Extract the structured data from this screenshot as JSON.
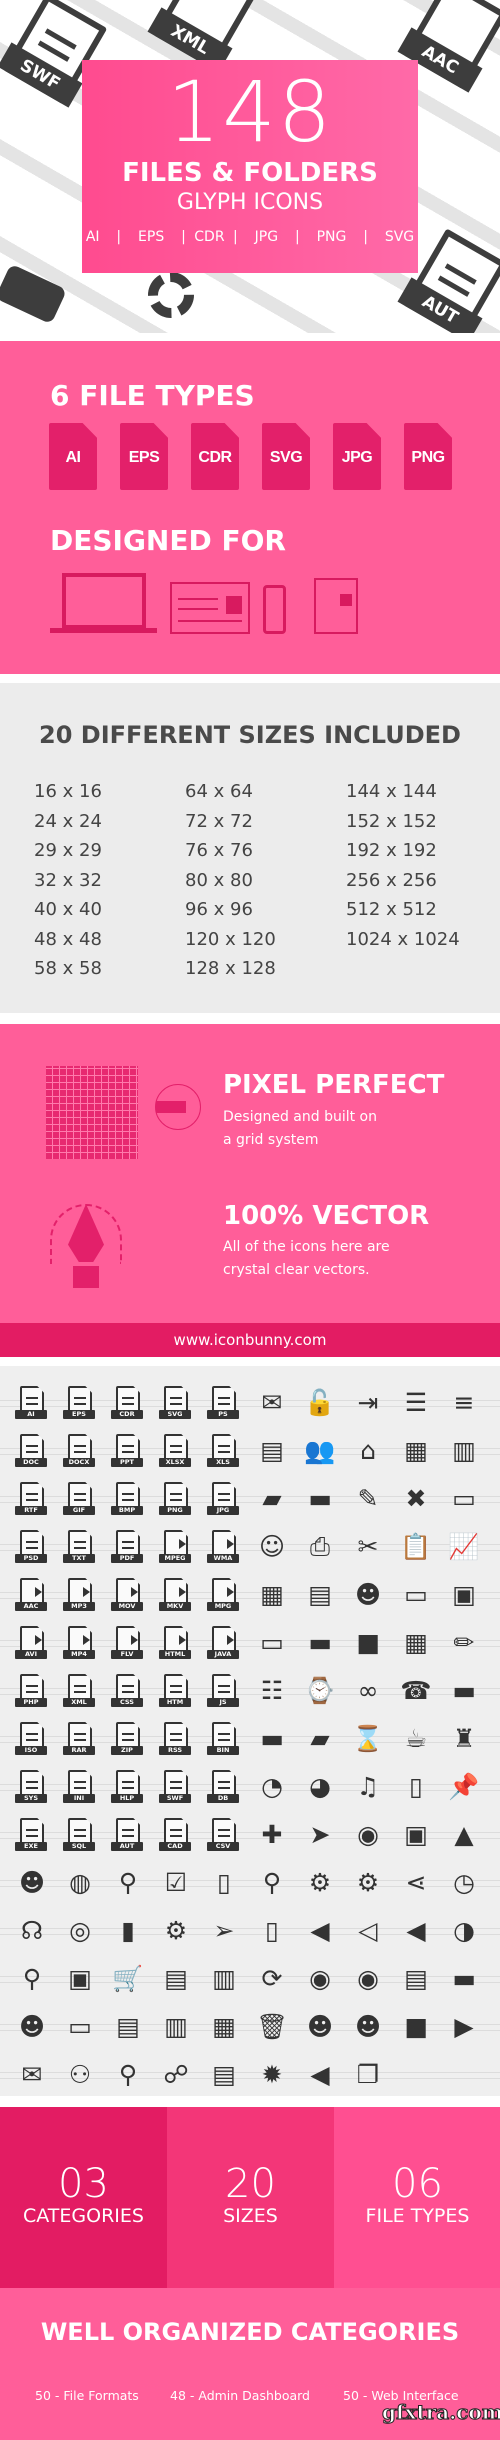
{
  "hero": {
    "count": "148",
    "title": "FILES & FOLDERS",
    "subtitle": "GLYPH ICONS",
    "formats": "AI  |  EPS  | CDR |  JPG  |  PNG  |  SVG",
    "bg_file_labels": [
      "SWF",
      "XML",
      "AAC",
      "AUT"
    ]
  },
  "file_types": {
    "title": "6 FILE TYPES",
    "items": [
      "AI",
      "EPS",
      "CDR",
      "SVG",
      "JPG",
      "PNG"
    ],
    "designed_title": "DESIGNED FOR",
    "devices": [
      "laptop-icon",
      "browser-icon",
      "phone-icon",
      "newspaper-icon"
    ]
  },
  "sizes": {
    "title": "20 DIFFERENT SIZES INCLUDED",
    "columns": [
      [
        "16 x 16",
        "24 x 24",
        "29 x 29",
        "32 x 32",
        "40 x 40",
        "48 x 48",
        "58 x 58"
      ],
      [
        "64 x 64",
        "72 x 72",
        "76 x 76",
        "80 x 80",
        "96 x 96",
        "120 x 120",
        "128 x 128"
      ],
      [
        "144 x 144",
        "152 x 152",
        "192 x 192",
        "256 x 256",
        "512 x 512",
        "1024 x 1024"
      ]
    ]
  },
  "features": {
    "pixel_title": "PIXEL PERFECT",
    "pixel_desc": "Designed and built on a grid system",
    "vector_title": "100% VECTOR",
    "vector_desc": "All of the icons here are crystal clear vectors.",
    "website": "www.iconbunny.com"
  },
  "icon_grid": {
    "file_labels": [
      "AI",
      "EPS",
      "CDR",
      "SVG",
      "PS",
      "DOC",
      "DOCX",
      "PPT",
      "XLSX",
      "XLS",
      "RTF",
      "GIF",
      "BMP",
      "PNG",
      "JPG",
      "PSD",
      "TXT",
      "PDF",
      "MPEG",
      "WMA",
      "AAC",
      "MP3",
      "MOV",
      "MKV",
      "MPG",
      "AVI",
      "MP4",
      "FLV",
      "HTML",
      "JAVA",
      "PHP",
      "XML",
      "CSS",
      "HTM",
      "JS",
      "ISO",
      "RAR",
      "ZIP",
      "RSS",
      "BIN",
      "SYS",
      "INI",
      "HLP",
      "SWF",
      "DB",
      "EXE",
      "SQL",
      "AUT",
      "CAD",
      "CSV"
    ],
    "media_labels": [
      "MPEG",
      "WMA",
      "AAC",
      "MP3",
      "MOV",
      "MKV",
      "MPG",
      "AVI",
      "MP4",
      "FLV",
      "HTML",
      "JAVA"
    ],
    "other_icons": [
      "mail-open",
      "unlock",
      "login",
      "list",
      "align-center",
      "newspaper",
      "users",
      "home",
      "calculator",
      "grid-list",
      "folder-open",
      "folder",
      "edit",
      "close-doc",
      "monitor",
      "user-add",
      "printer",
      "tools",
      "clipboard",
      "chart",
      "calendar",
      "money",
      "user-badge",
      "browser",
      "archive",
      "battery-low",
      "battery-mid",
      "battery-full",
      "calendar-alt",
      "pencil",
      "sliders",
      "watch",
      "glasses",
      "fax",
      "folder-tab",
      "folder-dark",
      "folder-open-dark",
      "hourglass",
      "cup",
      "lamp",
      "clock-sync",
      "refresh-clock",
      "music",
      "notebook",
      "pin",
      "puzzle",
      "send",
      "eye",
      "image",
      "landscape",
      "team",
      "group",
      "location",
      "checklist",
      "tablet",
      "location-pin",
      "gear",
      "gears",
      "share",
      "timer",
      "headset",
      "team-circle",
      "growth",
      "settings",
      "paper-plane",
      "phone-tablet",
      "volume",
      "volume-low",
      "volume-mute",
      "dashboard",
      "search-user",
      "save",
      "cart",
      "document",
      "newspaper-alt",
      "sync",
      "toggle",
      "toggle-on",
      "stack",
      "battery",
      "user-contact",
      "id-card",
      "document-stamp",
      "receipt",
      "calendar-day",
      "trash",
      "user",
      "user-female",
      "video",
      "video-player",
      "chat",
      "network",
      "route",
      "sitemap",
      "server",
      "settings-circle",
      "speaker",
      "windows"
    ]
  },
  "stats": [
    {
      "number": "03",
      "label": "CATEGORIES",
      "color": "#e31c63"
    },
    {
      "number": "20",
      "label": "SIZES",
      "color": "#f33678"
    },
    {
      "number": "06",
      "label": "FILE TYPES",
      "color": "#ff4f91"
    }
  ],
  "categories": {
    "title": "WELL ORGANIZED CATEGORIES",
    "items": [
      "50 - File Formats",
      "48 - Admin Dashboard",
      "50 - Web Interface"
    ]
  },
  "watermark": "gfxtra.com",
  "colors": {
    "pink": "#ff5e99",
    "dark_pink": "#e31c63",
    "glyph": "#333333",
    "gray_bg": "#ececec"
  }
}
